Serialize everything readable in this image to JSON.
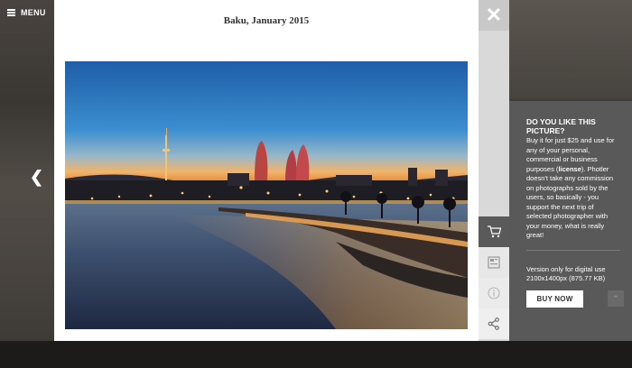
{
  "header": {
    "menu_label": "MENU"
  },
  "modal": {
    "caption": "Baku, January 2015"
  },
  "panel": {
    "title": "DO YOU LIKE THIS PICTURE?",
    "body_before": "Buy it for just $25 and use for any of your personal, commercial or business purposes (",
    "license_link": "license",
    "body_after": "). Photler doesn't take any commission on photographs sold by the users, so basically - you support the next trip of selected photographer with your money, what is really great!",
    "version_text": "Version only for digital use 2100x1400px (875.77 KB)",
    "buy_label": "BUY NOW"
  },
  "toolbar": {
    "close_icon": "close-icon",
    "tools": [
      "cart-icon",
      "image-icon",
      "info-icon",
      "share-icon"
    ]
  },
  "colors": {
    "panel_bg": "#595959",
    "toolbar_active": "#5a5a5a"
  }
}
